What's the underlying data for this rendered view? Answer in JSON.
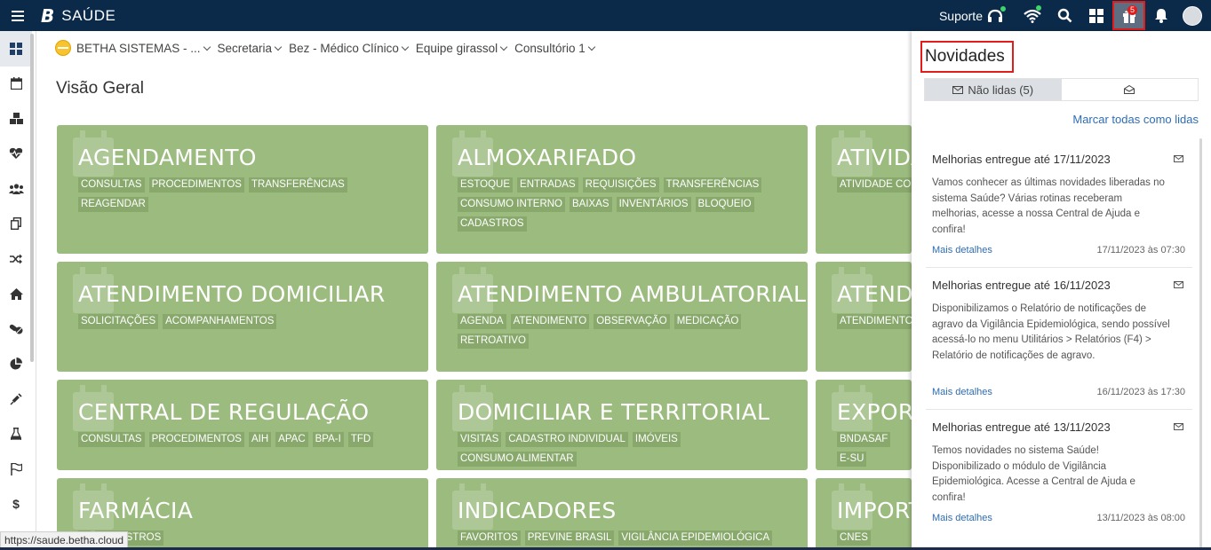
{
  "app": {
    "title": "SAÚDE",
    "logo": "B"
  },
  "topbar": {
    "suporte": "Suporte",
    "notifications_count": "5",
    "icons": [
      "menu-icon",
      "support-icon",
      "wifi-icon",
      "search-icon",
      "apps-icon",
      "gift-icon",
      "bell-icon",
      "avatar"
    ]
  },
  "breadcrumb": {
    "org": "BETHA SISTEMAS - ...",
    "items": [
      "Secretaria",
      "Bez - Médico Clínico",
      "Equipe girassol",
      "Consultório 1"
    ]
  },
  "page_title": "Visão Geral",
  "tiles": [
    {
      "title": "AGENDAMENTO",
      "tags": [
        "CONSULTAS",
        "PROCEDIMENTOS",
        "TRANSFERÊNCIAS",
        "REAGENDAR"
      ]
    },
    {
      "title": "ALMOXARIFADO",
      "tags": [
        "ESTOQUE",
        "ENTRADAS",
        "REQUISIÇÕES",
        "TRANSFERÊNCIAS",
        "CONSUMO INTERNO",
        "BAIXAS",
        "INVENTÁRIOS",
        "BLOQUEIO",
        "CADASTROS"
      ]
    },
    {
      "title": "ATIVIDA",
      "tags": [
        "ATIVIDADE COLE"
      ]
    },
    {
      "title": "ATENDIMENTO DOMICILIAR",
      "tags": [
        "SOLICITAÇÕES",
        "ACOMPANHAMENTOS"
      ]
    },
    {
      "title": "ATENDIMENTO AMBULATORIAL",
      "tags": [
        "AGENDA",
        "ATENDIMENTO",
        "OBSERVAÇÃO",
        "MEDICAÇÃO",
        "RETROATIVO"
      ]
    },
    {
      "title": "ATENDI",
      "tags": [
        "ATENDIMENTO"
      ]
    },
    {
      "title": "CENTRAL DE REGULAÇÃO",
      "tags": [
        "CONSULTAS",
        "PROCEDIMENTOS",
        "AIH",
        "APAC",
        "BPA-I",
        "TFD"
      ]
    },
    {
      "title": "DOMICILIAR E TERRITORIAL",
      "tags": [
        "VISITAS",
        "CADASTRO INDIVIDUAL",
        "IMÓVEIS",
        "CONSUMO ALIMENTAR"
      ]
    },
    {
      "title": "EXPORT",
      "tags": [
        "BNDASAF",
        "E-SU"
      ]
    },
    {
      "title": "FARMÁCIA",
      "tags": [
        "S",
        "CADASTROS"
      ]
    },
    {
      "title": "INDICADORES",
      "tags": [
        "FAVORITOS",
        "PREVINE BRASIL",
        "VIGILÂNCIA EPIDEMIOLÓGICA"
      ]
    },
    {
      "title": "IMPORT",
      "tags": [
        "CNES"
      ]
    }
  ],
  "panel": {
    "title": "Novidades",
    "tab_unread": "Não lidas (5)",
    "mark_all": "Marcar todas como lidas",
    "news": [
      {
        "title": "Melhorias entregue até 17/11/2023",
        "body": "Vamos conhecer as últimas novidades liberadas no sistema Saúde?  Várias rotinas receberam melhorias, acesse a nossa Central de Ajuda e confira!",
        "link": "Mais detalhes",
        "time": "17/11/2023 às 07:30"
      },
      {
        "title": "Melhorias entregue até 16/11/2023",
        "body": "Disponibilizamos o Relatório de notificações de agravo da Vigilância Epidemiológica, sendo possível acessá-lo no menu Utilitários > Relatórios (F4) > Relatório de notificações de agravo.",
        "link": "Mais detalhes",
        "time": "16/11/2023 às 17:30"
      },
      {
        "title": "Melhorias entregue até 13/11/2023",
        "body": "Temos novidades no sistema Saúde! Disponibilizado o módulo de Vigilância Epidemiológica. Acesse a Central de Ajuda e confira!",
        "link": "Mais detalhes",
        "time": "13/11/2023 às 08:00"
      }
    ]
  },
  "status_url": "https://saude.betha.cloud",
  "colors": {
    "topbar": "#0b2a4a",
    "tile": "#9cbb7f",
    "tag": "#88a86c",
    "link": "#2d6db4",
    "highlight": "#e21b1b"
  }
}
